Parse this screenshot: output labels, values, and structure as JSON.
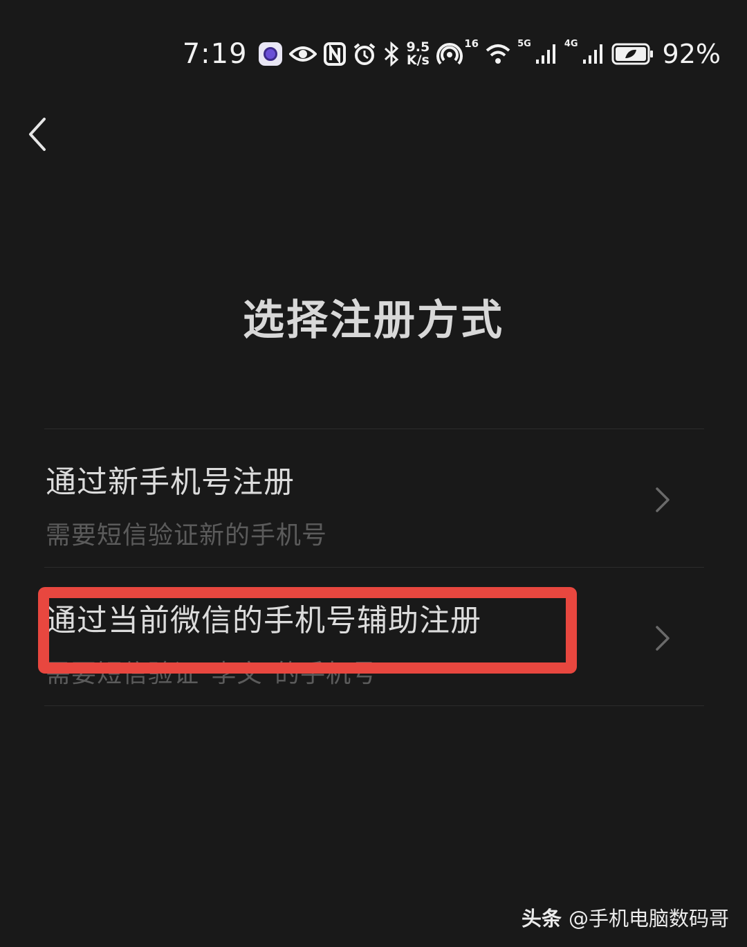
{
  "status_bar": {
    "time": "7:19",
    "net_speed_value": "9.5",
    "net_speed_unit": "K/s",
    "hotspot_count": "16",
    "signal1_tag": "5G",
    "signal2_tag": "4G",
    "battery_percent": "92%",
    "icons": [
      "app-icon",
      "eye-icon",
      "nfc-icon",
      "alarm-icon",
      "bluetooth-icon",
      "hotspot-icon",
      "wifi-icon",
      "signal-5g-icon",
      "signal-4g-icon",
      "battery-icon"
    ]
  },
  "nav": {
    "back_icon": "chevron-left-icon"
  },
  "page": {
    "title": "选择注册方式"
  },
  "options": [
    {
      "title": "通过新手机号注册",
      "description": "需要短信验证新的手机号"
    },
    {
      "title": "通过当前微信的手机号辅助注册",
      "description": "需要短信验证\"李文\"的手机号"
    }
  ],
  "annotation": {
    "highlight_color": "#e8473f"
  },
  "watermark": {
    "brand": "头条",
    "handle": "@手机电脑数码哥"
  },
  "colors": {
    "background": "#191919",
    "title": "#d8d8d8",
    "description": "#5b5b5b",
    "divider": "#2c2c2c"
  }
}
